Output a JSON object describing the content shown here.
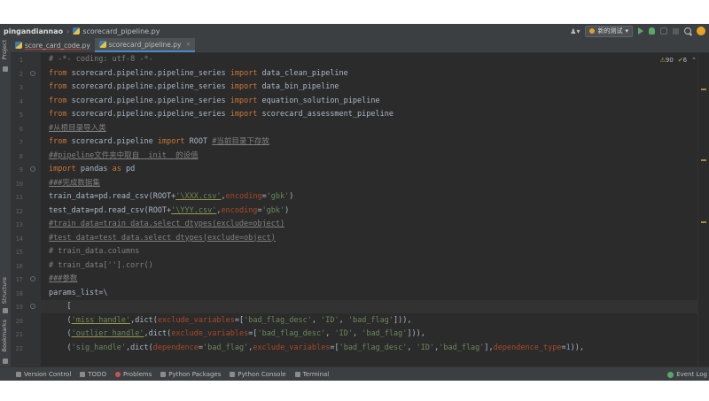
{
  "titlebar": {
    "project": "pingandiannao",
    "file": "scorecard_pipeline.py",
    "run_config": "新的测试"
  },
  "tabs": [
    {
      "label": "score_card_code.py"
    },
    {
      "label": "scorecard_pipeline.py",
      "close": "×"
    }
  ],
  "left_strip": {
    "project": "Project",
    "structure": "Structure",
    "bookmarks": "Bookmarks"
  },
  "inspection": {
    "warnings": "90",
    "weak_warnings": "6"
  },
  "line_numbers": [
    "1",
    "2",
    "3",
    "4",
    "5",
    "6",
    "7",
    "8",
    "9",
    "10",
    "11",
    "12",
    "13",
    "14",
    "15",
    "16",
    "17",
    "18",
    "19",
    "20",
    "21",
    "22"
  ],
  "code": {
    "l1": "# -*- coding: utf-8 -*-",
    "l2_a": "from",
    "l2_b": " scorecard.pipeline.pipeline_series ",
    "l2_c": "import",
    "l2_d": " data_clean_pipeline",
    "l3_d": " data_bin_pipeline",
    "l4_d": " equation_solution_pipeline",
    "l5_d": " scorecard_assessment_pipeline",
    "l6": "#从根目录导入类",
    "l7_b": " scorecard.pipeline ",
    "l7_d": " ROOT ",
    "l7_e": "#当前目录下存放",
    "l8": "##pipeline文件夹中取自__init__的设值",
    "l9_a": "import",
    "l9_b": " pandas ",
    "l9_c": "as",
    "l9_d": " pd",
    "l10": "###完成数据集",
    "l11_a": "train_data=pd.read_csv(ROOT+",
    "l11_b": "'\\XXX.csv'",
    "l11_c": ",",
    "l11_d": "encoding",
    "l11_e": "=",
    "l11_f": "'gbk'",
    "l11_g": ")",
    "l12_a": "test_data=pd.read_csv(ROOT+",
    "l12_b": "'\\YYY.csv'",
    "l13": "#train_data=train_data.select_dtypes(exclude=object)",
    "l14": "#test_data=test_data.select_dtypes(exclude=object)",
    "l15": "# train_data.columns",
    "l16": "# train_data[''].corr()",
    "l17": "###参数",
    "l18": "params_list=\\",
    "l19": "    [",
    "l20_a": "    (",
    "l20_b": "'miss_handle'",
    "l20_c": ",dict(",
    "l20_d": "exclude_variables",
    "l20_e": "=[",
    "l20_f": "'bad_flag_desc'",
    "l20_g": ", ",
    "l20_h": "'ID'",
    "l20_i": "'bad_flag'",
    "l20_j": "])),",
    "l21_b": "'outlier_handle'",
    "l22_a": "    (",
    "l22_b": "'sig_handle'",
    "l22_c": ",dict(",
    "l22_d": "dependence",
    "l22_e": "=",
    "l22_f": "'bad_flag'",
    "l22_g": ",",
    "l22_h": "exclude_variables",
    "l22_i": "=[",
    "l22_j": "'bad_flag_desc'",
    "l22_k": ", ",
    "l22_l": "'ID'",
    "l22_m": ",",
    "l22_n": "'bad_flag'",
    "l22_o": "],",
    "l22_p": "dependence_type",
    "l22_q": "=",
    "l22_r": "1",
    "l22_s": ")),"
  },
  "bottom": {
    "version_control": "Version Control",
    "todo": "TODO",
    "problems": "Problems",
    "packages": "Python Packages",
    "console": "Python Console",
    "terminal": "Terminal",
    "event_log": "Event Log"
  }
}
